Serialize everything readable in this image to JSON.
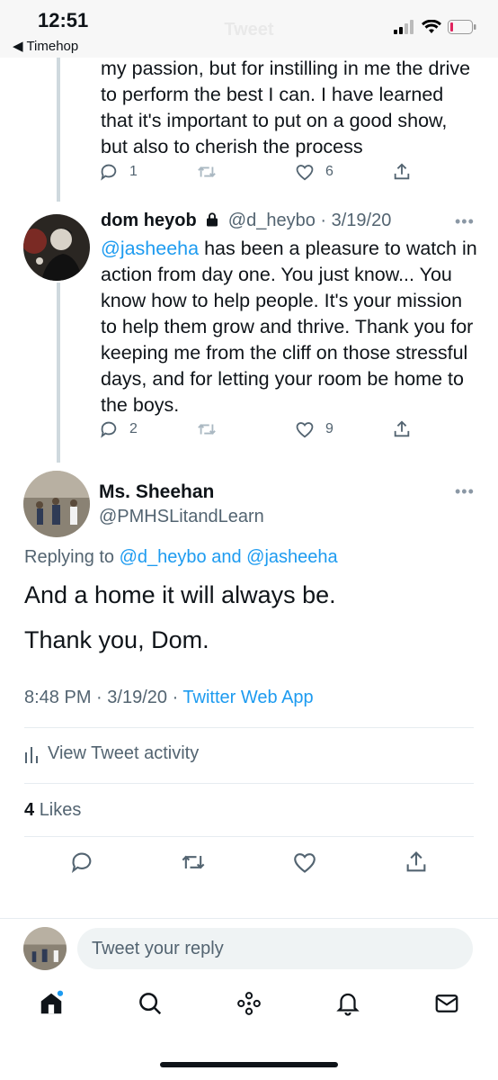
{
  "status_bar": {
    "time": "12:51",
    "back_app": "Timehop",
    "header_title": "Tweet"
  },
  "reply_1": {
    "text_lines": [
      "my passion, but for instilling in me the drive",
      "to perform the best I can. I have learned",
      "that it's important to put on a good show,",
      "but also to cherish the process"
    ],
    "reply_count": "1",
    "like_count": "6"
  },
  "reply_2": {
    "name": "dom heyob",
    "handle": "@d_heybo",
    "date": "3/19/20",
    "mention": "@jasheeha",
    "text_first": "has been a pleasure to watch in",
    "text_lines": [
      "action from day one. You just know... You",
      "know how to help people. It's your mission",
      "to help them grow and thrive. Thank you for",
      "keeping me from the cliff on those stressful",
      "days, and for letting your room be home to",
      "the boys."
    ],
    "reply_count": "2",
    "like_count": "9"
  },
  "main_tweet": {
    "name": "Ms. Sheehan",
    "handle": "@PMHSLitandLearn",
    "replying_prefix": "Replying to",
    "replying_to_1": "@d_heybo",
    "replying_and": "and",
    "replying_to_2": "@jasheeha",
    "line1": "And a home it will always be.",
    "line2": "Thank you, Dom.",
    "time": "8:48 PM",
    "date": "3/19/20",
    "client": "Twitter Web App",
    "activity_label": "View Tweet activity",
    "likes_count": "4",
    "likes_label": "Likes"
  },
  "reply_composer": {
    "placeholder": "Tweet your reply"
  },
  "colors": {
    "accent": "#1d9bf0",
    "muted": "#536471",
    "text": "#0f1419",
    "battery_low": "#e0245e"
  },
  "icons": [
    "signal-icon",
    "wifi-icon",
    "battery-icon",
    "reply-icon",
    "retweet-icon",
    "like-icon",
    "share-icon",
    "lock-icon",
    "more-icon",
    "activity-icon",
    "home-icon",
    "search-icon",
    "spaces-icon",
    "notifications-icon",
    "messages-icon"
  ]
}
